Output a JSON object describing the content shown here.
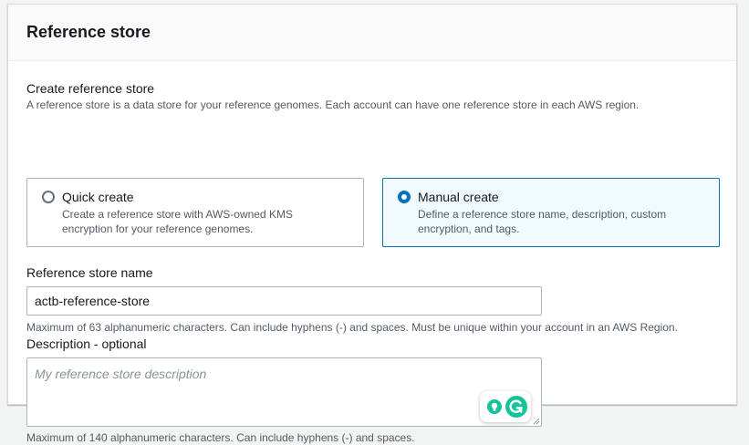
{
  "panel": {
    "title": "Reference store"
  },
  "create": {
    "label": "Create reference store",
    "description": "A reference store is a data store for your reference genomes. Each account can have one reference store in each AWS region.",
    "options": [
      {
        "label": "Quick create",
        "description": "Create a reference store with AWS-owned KMS encryption for your reference genomes.",
        "selected": false
      },
      {
        "label": "Manual create",
        "description": "Define a reference store name, description, custom encryption, and tags.",
        "selected": true
      }
    ]
  },
  "name_field": {
    "label": "Reference store name",
    "value": "actb-reference-store",
    "hint": "Maximum of 63 alphanumeric characters. Can include hyphens (-) and spaces. Must be unique within your account in an AWS Region."
  },
  "description_field": {
    "label": "Description - optional",
    "placeholder": "My reference store description",
    "hint": "Maximum of 140 alphanumeric characters. Can include hyphens (-) and spaces."
  },
  "colors": {
    "accent": "#0073bb",
    "selected_tile_bg": "#f1faff",
    "grammarly_green": "#15c39a"
  },
  "icons": {
    "grammarly_suggestion": "lightbulb-icon",
    "grammarly_logo": "grammarly-g-icon",
    "resize_handle": "resize-handle-icon"
  }
}
